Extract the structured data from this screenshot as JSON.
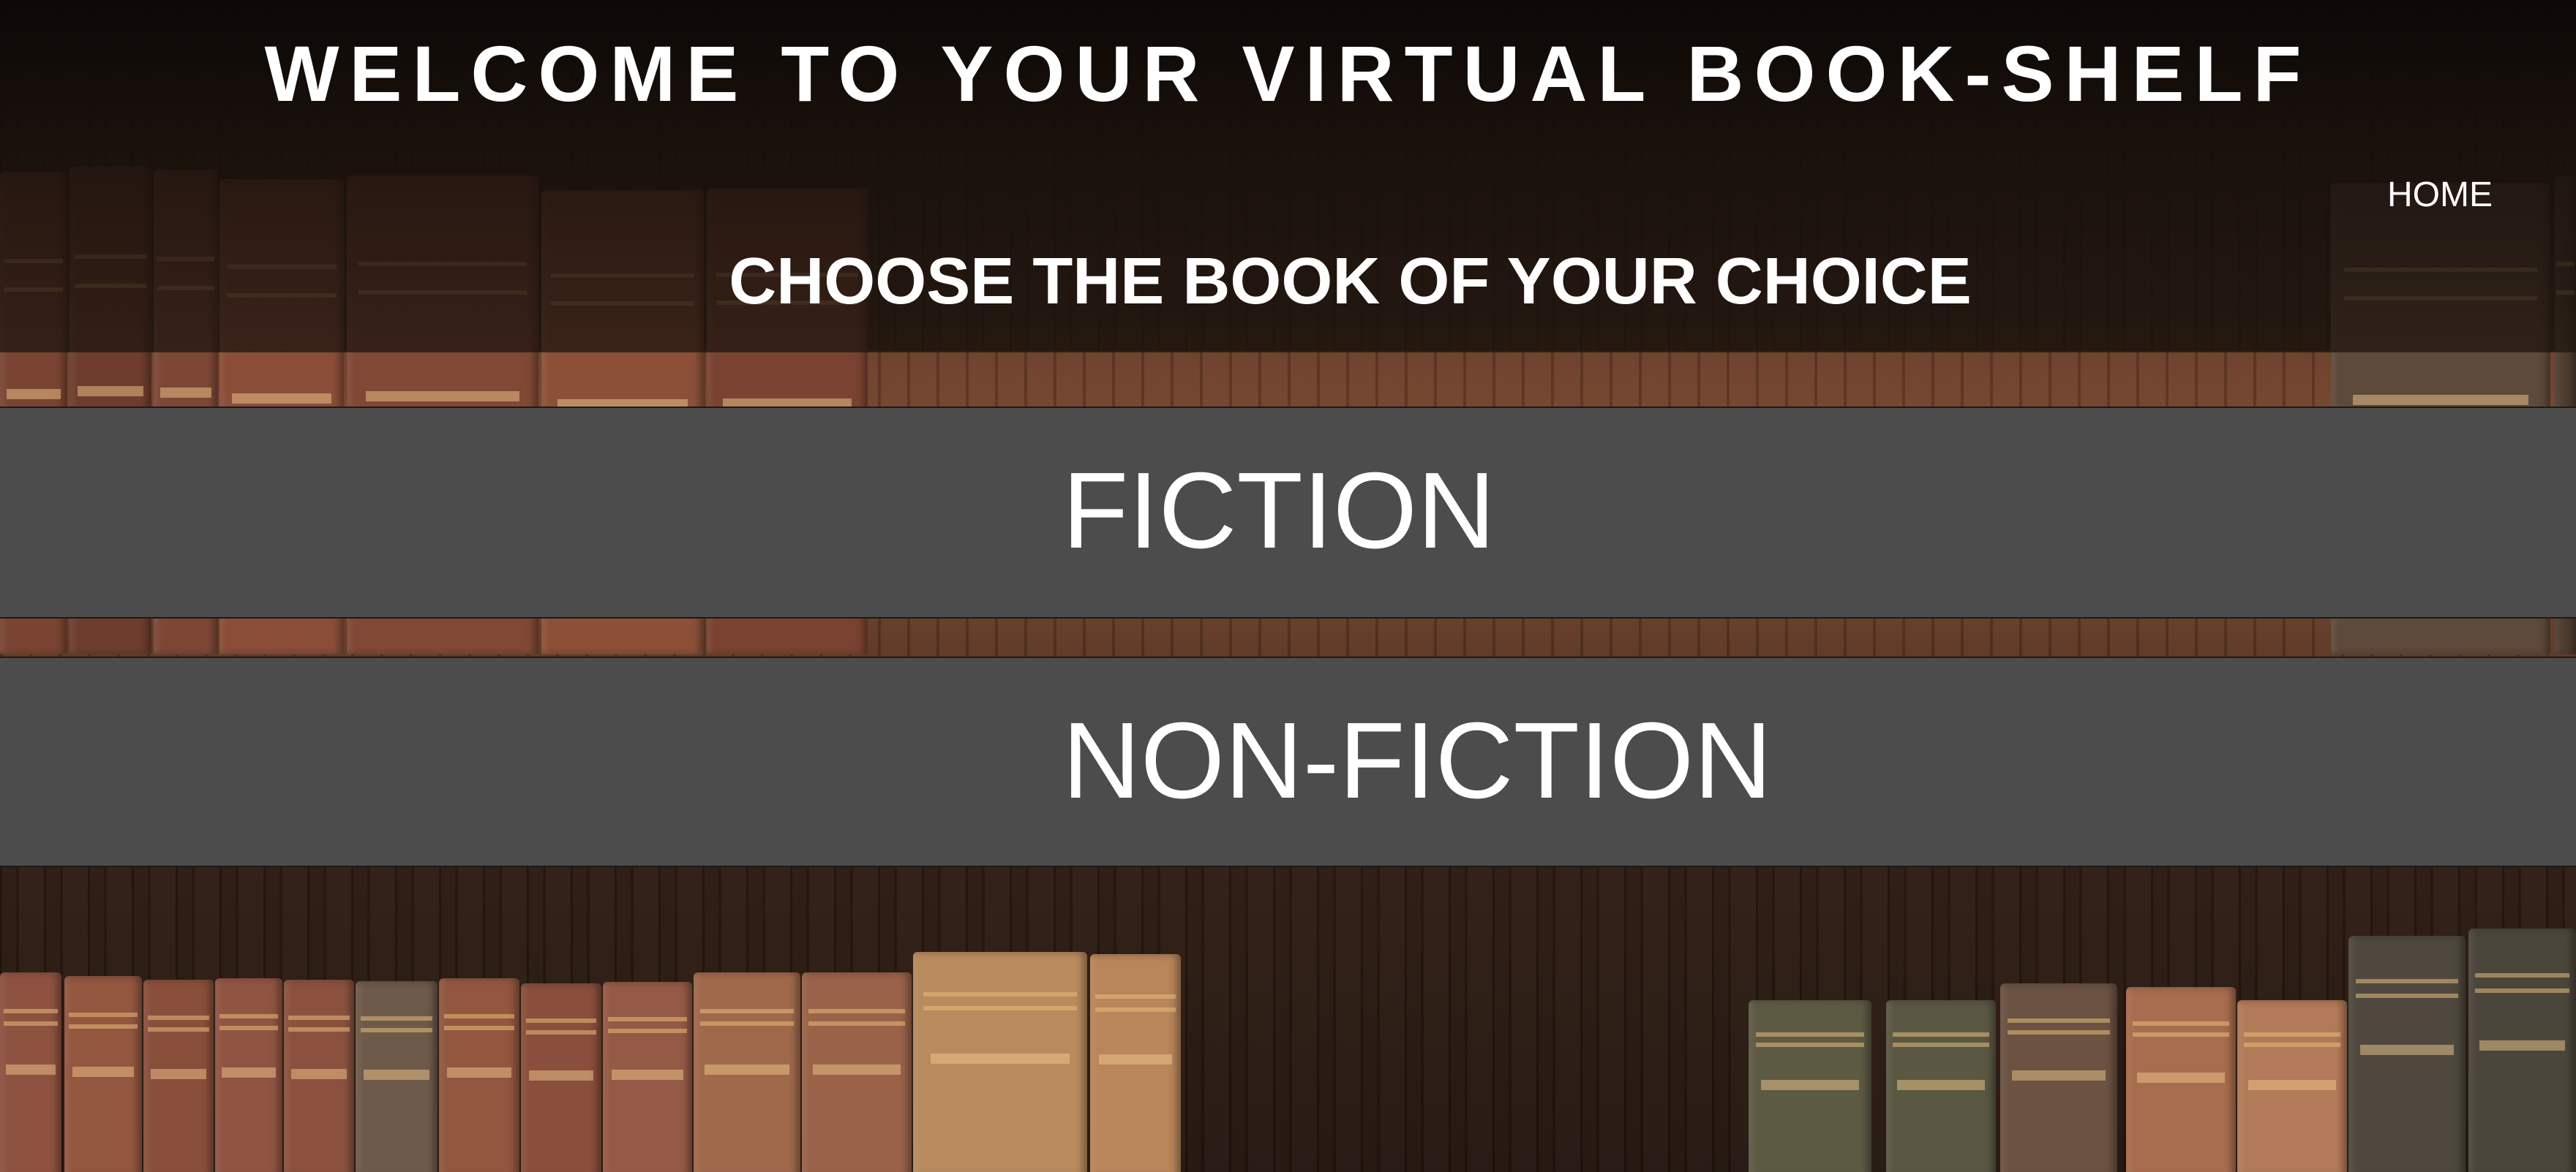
{
  "header": {
    "title": "WELCOME TO YOUR VIRTUAL BOOK-SHELF"
  },
  "nav": {
    "home_label": "HOME"
  },
  "main": {
    "heading": "CHOOSE THE BOOK OF YOUR CHOICE",
    "categories": [
      {
        "label": "FICTION"
      },
      {
        "label": "NON-FICTION"
      }
    ]
  },
  "colors": {
    "category_bar": "#4c4c4c",
    "text": "#ffffff",
    "header_band": "#120c09"
  }
}
